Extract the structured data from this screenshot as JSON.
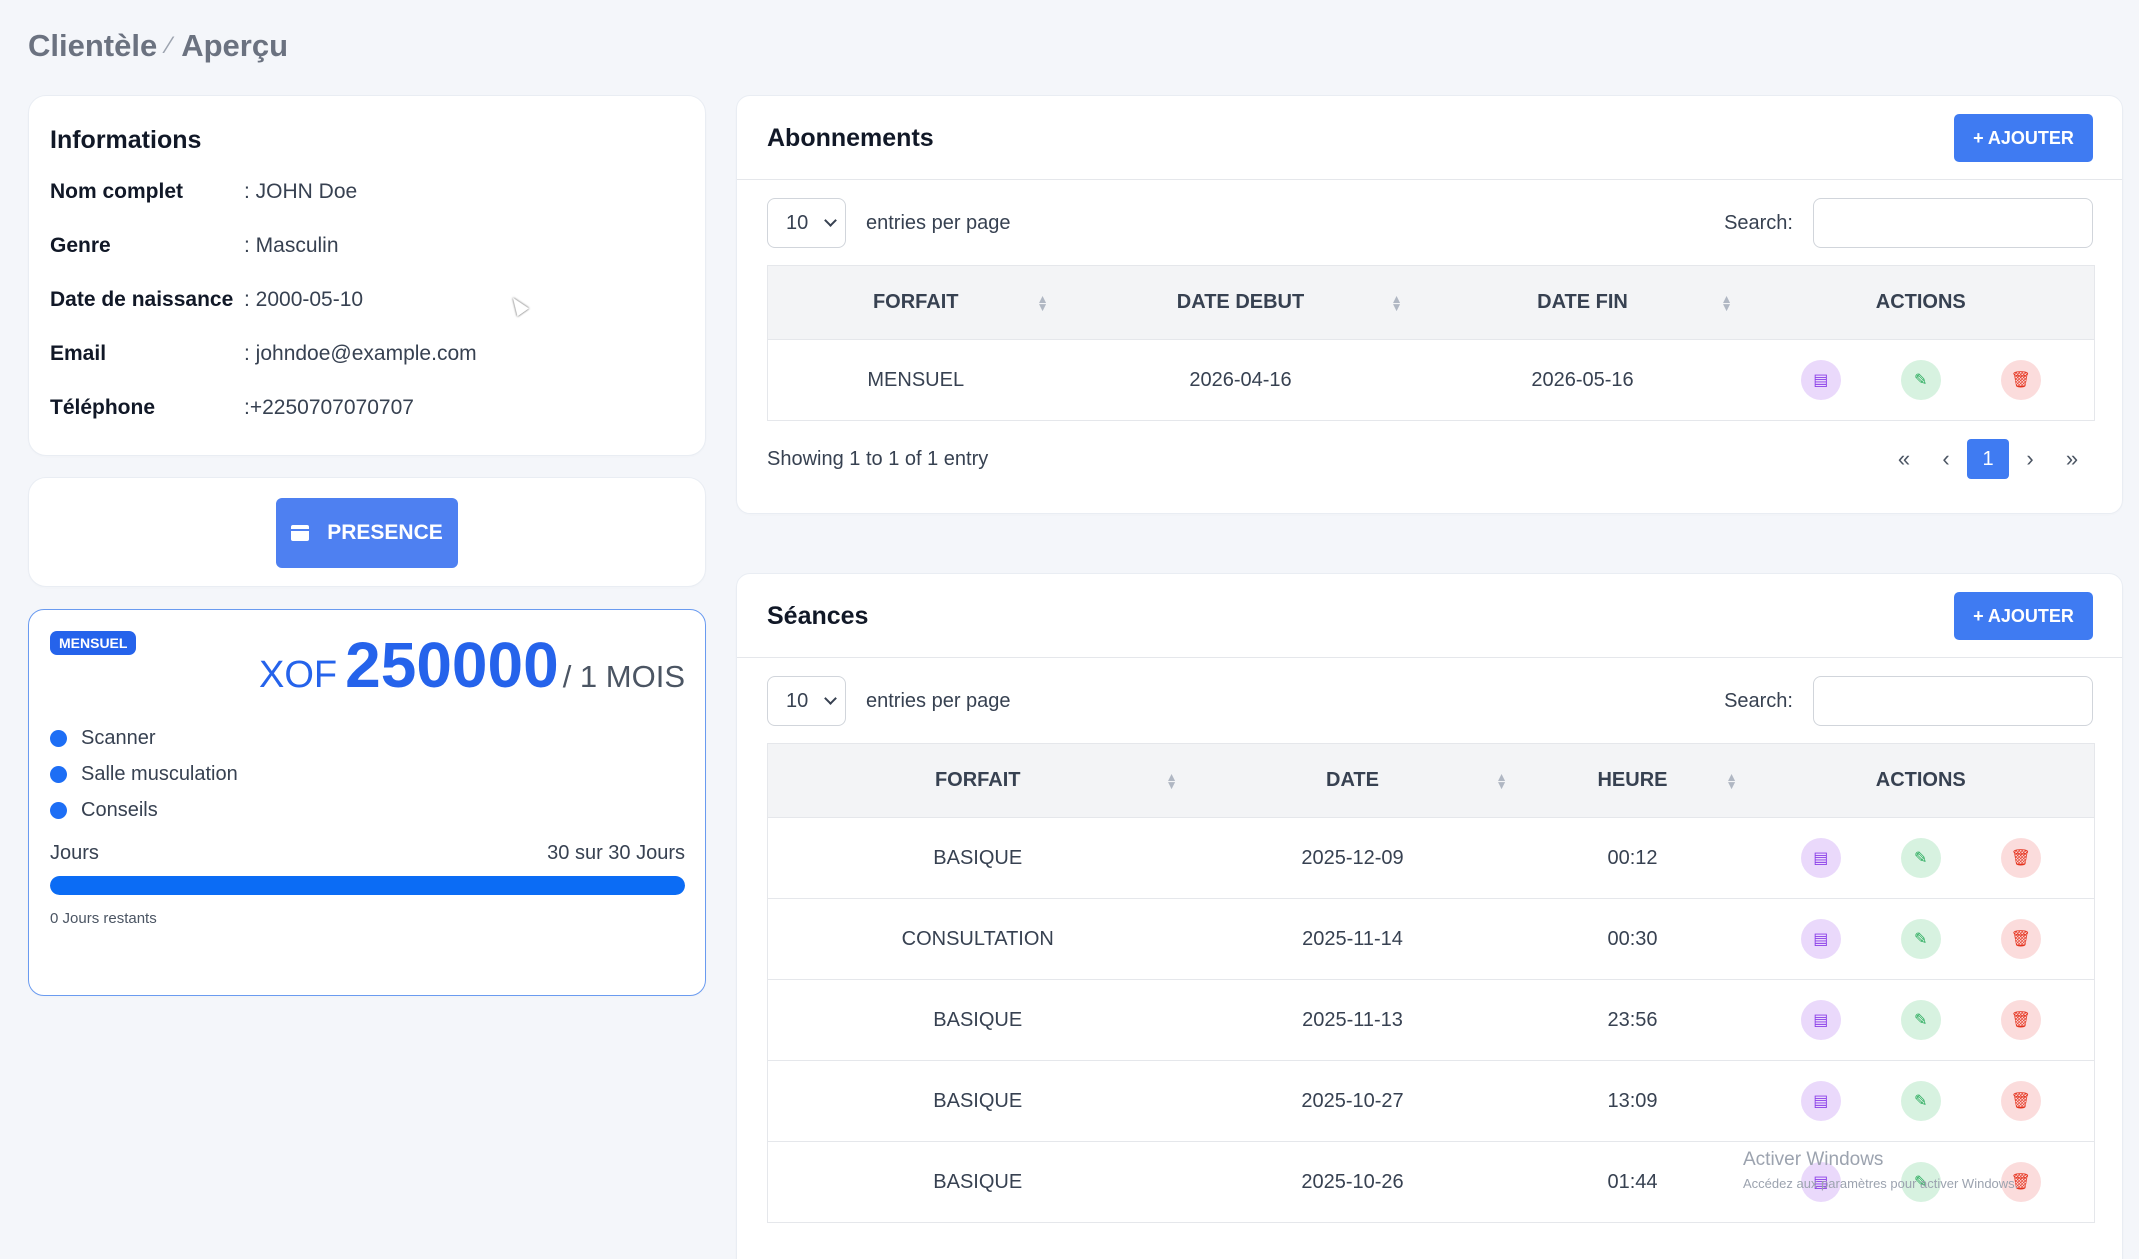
{
  "breadcrumb": {
    "root": "Clientèle",
    "sep": "⁄",
    "current": "Aperçu"
  },
  "info": {
    "title": "Informations",
    "rows": [
      {
        "label": "Nom complet",
        "value": ": JOHN Doe"
      },
      {
        "label": "Genre",
        "value": ": Masculin"
      },
      {
        "label": "Date de naissance",
        "value": ": 2000-05-10"
      },
      {
        "label": "Email",
        "value": ": johndoe@example.com"
      },
      {
        "label": "Téléphone",
        "value": ":+2250707070707"
      }
    ]
  },
  "presence": {
    "label": "PRESENCE"
  },
  "plan": {
    "badge": "MENSUEL",
    "currency": "XOF",
    "amount": "250000",
    "period": "/ 1 MOIS",
    "features": [
      "Scanner",
      "Salle musculation",
      "Conseils"
    ],
    "days_label": "Jours",
    "days_value": "30 sur 30 Jours",
    "progress_percent": 100,
    "remaining": "0 Jours restants",
    "accent": "#2563eb"
  },
  "abonnements": {
    "title": "Abonnements",
    "add_label": "+ AJOUTER",
    "per_page": "10",
    "entries_label": "entries per page",
    "search_label": "Search:",
    "columns": [
      "FORFAIT",
      "DATE DEBUT",
      "DATE FIN",
      "ACTIONS"
    ],
    "rows": [
      {
        "forfait": "MENSUEL",
        "debut": "2026-04-16",
        "fin": "2026-05-16"
      }
    ],
    "showing": "Showing 1 to 1 of 1 entry",
    "pager": {
      "first": "«",
      "prev": "‹",
      "page": "1",
      "next": "›",
      "last": "»"
    }
  },
  "seances": {
    "title": "Séances",
    "add_label": "+ AJOUTER",
    "per_page": "10",
    "entries_label": "entries per page",
    "search_label": "Search:",
    "columns": [
      "FORFAIT",
      "DATE",
      "HEURE",
      "ACTIONS"
    ],
    "rows": [
      {
        "forfait": "BASIQUE",
        "date": "2025-12-09",
        "heure": "00:12"
      },
      {
        "forfait": "CONSULTATION",
        "date": "2025-11-14",
        "heure": "00:30"
      },
      {
        "forfait": "BASIQUE",
        "date": "2025-11-13",
        "heure": "23:56"
      },
      {
        "forfait": "BASIQUE",
        "date": "2025-10-27",
        "heure": "13:09"
      },
      {
        "forfait": "BASIQUE",
        "date": "2025-10-26",
        "heure": "01:44"
      }
    ]
  },
  "watermark": {
    "line1": "Activer Windows",
    "line2": "Accédez aux paramètres pour activer Windows."
  },
  "icons": {
    "view": "message-icon",
    "edit": "edit-icon",
    "delete": "trash-icon",
    "calendar": "calendar-icon"
  }
}
